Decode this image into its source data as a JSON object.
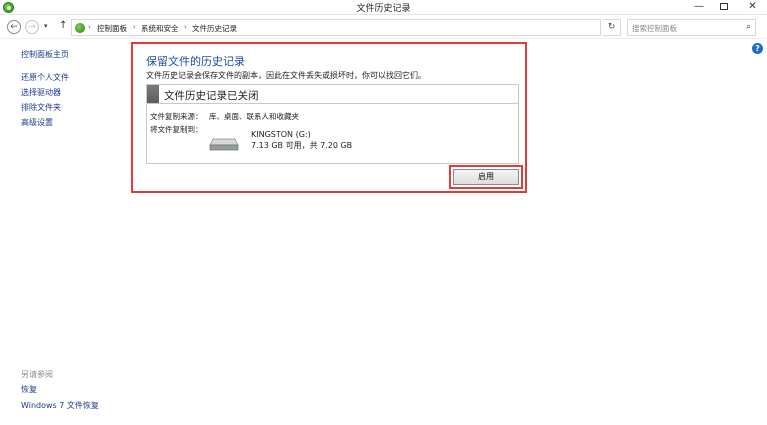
{
  "window": {
    "title": "文件历史记录",
    "minimize_glyph": "—",
    "close_glyph": "✕"
  },
  "nav": {
    "back_glyph": "←",
    "forward_glyph": "→",
    "recent_glyph": "▾",
    "up_glyph": "↑",
    "breadcrumb": [
      "控制面板",
      "系统和安全",
      "文件历史记录"
    ],
    "separator": "›",
    "dropdown_glyph": "▾",
    "refresh_glyph": "↻",
    "search_placeholder": "搜索控制面板",
    "search_glyph": "⌕"
  },
  "help_glyph": "?",
  "sidebar": {
    "home": "控制面板主页",
    "items": [
      "还原个人文件",
      "选择驱动器",
      "排除文件夹",
      "高级设置"
    ],
    "see_also_title": "另请参阅",
    "see_also": [
      "恢复",
      "Windows 7 文件恢复"
    ]
  },
  "main": {
    "heading": "保留文件的历史记录",
    "description": "文件历史记录会保存文件的副本，因此在文件丢失或损坏时，你可以找回它们。",
    "status_title": "文件历史记录已关闭",
    "source_label": "文件复制来源：",
    "source_value": "库、桌面、联系人和收藏夹",
    "target_label": "将文件复制到：",
    "drive_name": "KINGSTON (G:)",
    "drive_space": "7.13 GB 可用，共 7.20 GB",
    "enable_button": "启用"
  },
  "colors": {
    "link": "#1a3b8a",
    "heading": "#1f4e9c",
    "highlight": "#e23b3b"
  }
}
